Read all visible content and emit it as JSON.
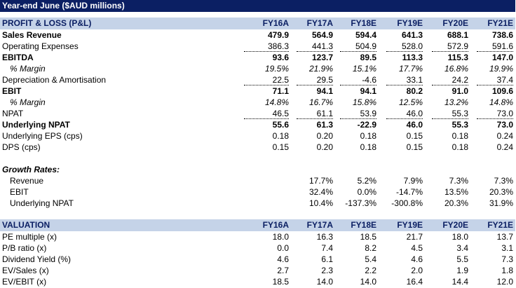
{
  "title": "Year-end June ($AUD millions)",
  "years": [
    "FY16A",
    "FY17A",
    "FY18E",
    "FY19E",
    "FY20E",
    "FY21E"
  ],
  "pl": {
    "header": "PROFIT & LOSS (P&L)",
    "rows": [
      {
        "label": "Sales Revenue",
        "values": [
          "479.9",
          "564.9",
          "594.4",
          "641.3",
          "688.1",
          "738.6"
        ]
      },
      {
        "label": "Operating Expenses",
        "values": [
          "386.3",
          "441.3",
          "504.9",
          "528.0",
          "572.9",
          "591.6"
        ]
      },
      {
        "label": "EBITDA",
        "values": [
          "93.6",
          "123.7",
          "89.5",
          "113.3",
          "115.3",
          "147.0"
        ]
      },
      {
        "label": "% Margin",
        "values": [
          "19.5%",
          "21.9%",
          "15.1%",
          "17.7%",
          "16.8%",
          "19.9%"
        ]
      },
      {
        "label": "Depreciation & Amortisation",
        "values": [
          "22.5",
          "29.5",
          "-4.6",
          "33.1",
          "24.2",
          "37.4"
        ]
      },
      {
        "label": "EBIT",
        "values": [
          "71.1",
          "94.1",
          "94.1",
          "80.2",
          "91.0",
          "109.6"
        ]
      },
      {
        "label": "% Margin",
        "values": [
          "14.8%",
          "16.7%",
          "15.8%",
          "12.5%",
          "13.2%",
          "14.8%"
        ]
      },
      {
        "label": "NPAT",
        "values": [
          "46.5",
          "61.1",
          "53.9",
          "46.0",
          "55.3",
          "73.0"
        ]
      },
      {
        "label": "Underlying NPAT",
        "values": [
          "55.6",
          "61.3",
          "-22.9",
          "46.0",
          "55.3",
          "73.0"
        ]
      },
      {
        "label": "Underlying EPS (cps)",
        "values": [
          "0.18",
          "0.20",
          "0.18",
          "0.15",
          "0.18",
          "0.24"
        ]
      },
      {
        "label": "DPS (cps)",
        "values": [
          "0.15",
          "0.20",
          "0.18",
          "0.15",
          "0.18",
          "0.24"
        ]
      }
    ]
  },
  "growth": {
    "header": "Growth Rates:",
    "rows": [
      {
        "label": "Revenue",
        "values": [
          "",
          "17.7%",
          "5.2%",
          "7.9%",
          "7.3%",
          "7.3%"
        ]
      },
      {
        "label": "EBIT",
        "values": [
          "",
          "32.4%",
          "0.0%",
          "-14.7%",
          "13.5%",
          "20.3%"
        ]
      },
      {
        "label": "Underlying NPAT",
        "values": [
          "",
          "10.4%",
          "-137.3%",
          "-300.8%",
          "20.3%",
          "31.9%"
        ]
      }
    ]
  },
  "valuation": {
    "header": "VALUATION",
    "rows": [
      {
        "label": "PE multiple (x)",
        "values": [
          "18.0",
          "16.3",
          "18.5",
          "21.7",
          "18.0",
          "13.7"
        ]
      },
      {
        "label": "P/B ratio (x)",
        "values": [
          "0.0",
          "7.4",
          "8.2",
          "4.5",
          "3.4",
          "3.1"
        ]
      },
      {
        "label": "Dividend Yield (%)",
        "values": [
          "4.6",
          "6.1",
          "5.4",
          "4.6",
          "5.5",
          "7.3"
        ]
      },
      {
        "label": "EV/Sales (x)",
        "values": [
          "2.7",
          "2.3",
          "2.2",
          "2.0",
          "1.9",
          "1.8"
        ]
      },
      {
        "label": "EV/EBIT (x)",
        "values": [
          "18.5",
          "14.0",
          "14.0",
          "16.4",
          "14.4",
          "12.0"
        ]
      }
    ]
  },
  "colors": {
    "title_bg": "#0b1f63",
    "header_bg": "#c5d3e8",
    "header_text": "#0b1f63"
  }
}
